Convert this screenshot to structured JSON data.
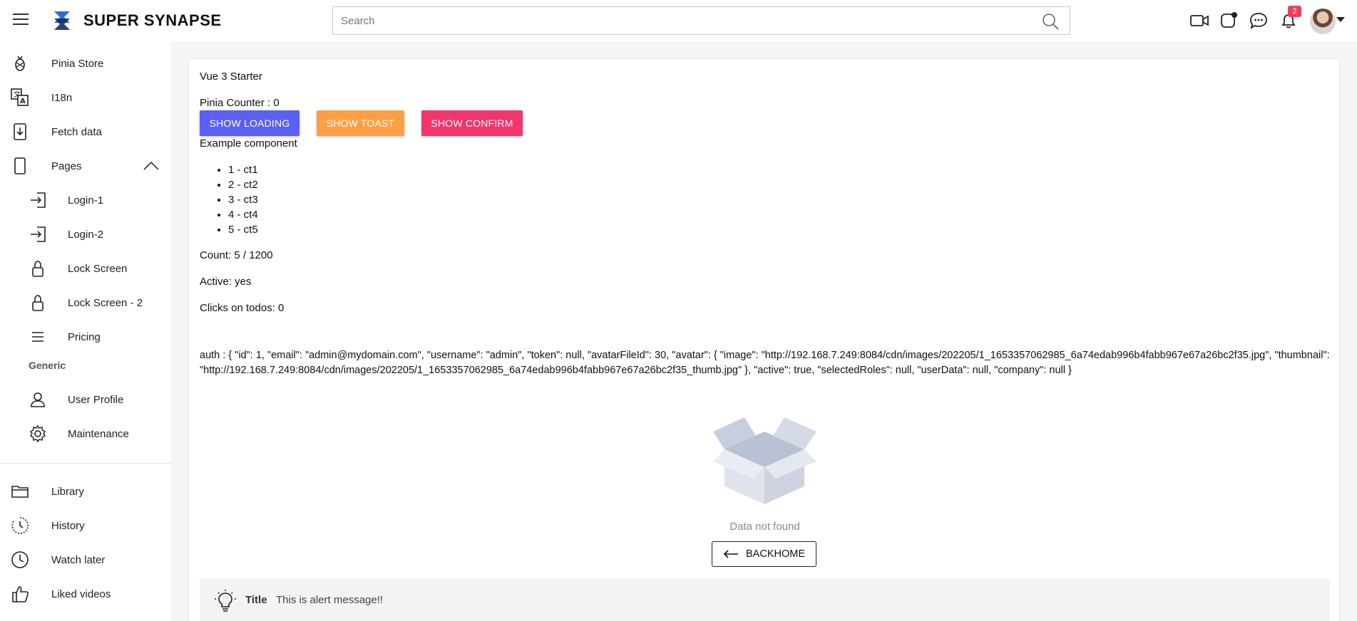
{
  "header": {
    "brand": "SUPER SYNAPSE",
    "search_placeholder": "Search",
    "notification_count": "2",
    "icons": [
      "menu-icon",
      "logo-icon",
      "search-icon",
      "video-icon",
      "apps-icon",
      "chat-icon",
      "bell-icon",
      "avatar"
    ]
  },
  "sidebar": {
    "items": [
      {
        "label": "Pinia Store",
        "icon": "pineapple-icon"
      },
      {
        "label": "I18n",
        "icon": "translate-icon"
      },
      {
        "label": "Fetch data",
        "icon": "download-icon"
      },
      {
        "label": "Pages",
        "icon": "page-icon"
      }
    ],
    "sub_items": [
      {
        "label": "Login-1",
        "icon": "login-icon"
      },
      {
        "label": "Login-2",
        "icon": "login-icon"
      },
      {
        "label": "Lock Screen",
        "icon": "lock-icon"
      },
      {
        "label": "Lock Screen - 2",
        "icon": "lock-icon"
      },
      {
        "label": "Pricing",
        "icon": "list-icon"
      }
    ],
    "generic_label": "Generic",
    "generic_items": [
      {
        "label": "User Profile",
        "icon": "user-icon"
      },
      {
        "label": "Maintenance",
        "icon": "gear-icon"
      }
    ],
    "bottom_items": [
      {
        "label": "Library",
        "icon": "folder-icon"
      },
      {
        "label": "History",
        "icon": "history-icon"
      },
      {
        "label": "Watch later",
        "icon": "clock-icon"
      },
      {
        "label": "Liked videos",
        "icon": "thumbs-up-icon"
      }
    ]
  },
  "main": {
    "title": "Vue 3 Starter",
    "counter_text": "Pinia Counter : 0",
    "buttons": {
      "loading": "SHOW LOADING",
      "toast": "SHOW TOAST",
      "confirm": "SHOW CONFIRM"
    },
    "button_colors": {
      "loading": "#5a60f5",
      "toast": "#ff9f43",
      "confirm": "#f2356a"
    },
    "example_heading": "Example component",
    "todos": [
      "1 - ct1",
      "2 - ct2",
      "3 - ct3",
      "4 - ct4",
      "5 - ct5"
    ],
    "count_text": "Count: 5 / 1200",
    "active_text": "Active: yes",
    "clicks_text": "Clicks on todos: 0",
    "auth_text": "auth : { \"id\": 1, \"email\": \"admin@mydomain.com\", \"username\": \"admin\", \"token\": null, \"avatarFileId\": 30, \"avatar\": { \"image\": \"http://192.168.7.249:8084/cdn/images/202205/1_1653357062985_6a74edab996b4fabb967e67a26bc2f35.jpg\", \"thumbnail\": \"http://192.168.7.249:8084/cdn/images/202205/1_1653357062985_6a74edab996b4fabb967e67a26bc2f35_thumb.jpg\" }, \"active\": true, \"selectedRoles\": null, \"userData\": null, \"company\": null }",
    "empty_text": "Data not found",
    "backhome_label": "BACKHOME",
    "alert": {
      "title": "Title",
      "message": "This is alert message!!"
    }
  }
}
